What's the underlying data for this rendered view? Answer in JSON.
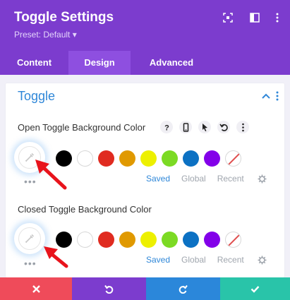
{
  "header": {
    "title": "Toggle Settings",
    "preset": "Preset: Default",
    "preset_caret": "▾",
    "bg_color": "#7c3cce"
  },
  "tabs": [
    {
      "label": "Content",
      "active": false
    },
    {
      "label": "Design",
      "active": true
    },
    {
      "label": "Advanced",
      "active": false
    }
  ],
  "section": {
    "title": "Toggle",
    "collapsed": false
  },
  "fields": [
    {
      "label": "Open Toggle Background Color",
      "tools": [
        "help-icon",
        "mobile-icon",
        "cursor-icon",
        "reset-icon",
        "more-icon"
      ],
      "swatches": [
        "#000000",
        "#ffffff",
        "#e02b20",
        "#e09900",
        "#edf000",
        "#7cda24",
        "#0c71c3",
        "#8300e9",
        "none"
      ],
      "links": {
        "saved": "Saved",
        "global": "Global",
        "recent": "Recent"
      },
      "dots": "•••"
    },
    {
      "label": "Closed Toggle Background Color",
      "swatches": [
        "#000000",
        "#ffffff",
        "#e02b20",
        "#e09900",
        "#edf000",
        "#7cda24",
        "#0c71c3",
        "#8300e9",
        "none"
      ],
      "links": {
        "saved": "Saved",
        "global": "Global",
        "recent": "Recent"
      },
      "dots": "•••"
    }
  ],
  "footer": {
    "buttons": [
      {
        "name": "cancel",
        "icon": "close-icon",
        "color": "#ef4b5a"
      },
      {
        "name": "undo",
        "icon": "undo-icon",
        "color": "#7c3cce"
      },
      {
        "name": "redo",
        "icon": "redo-icon",
        "color": "#2b87da"
      },
      {
        "name": "save",
        "icon": "check-icon",
        "color": "#29c4a9"
      }
    ]
  }
}
